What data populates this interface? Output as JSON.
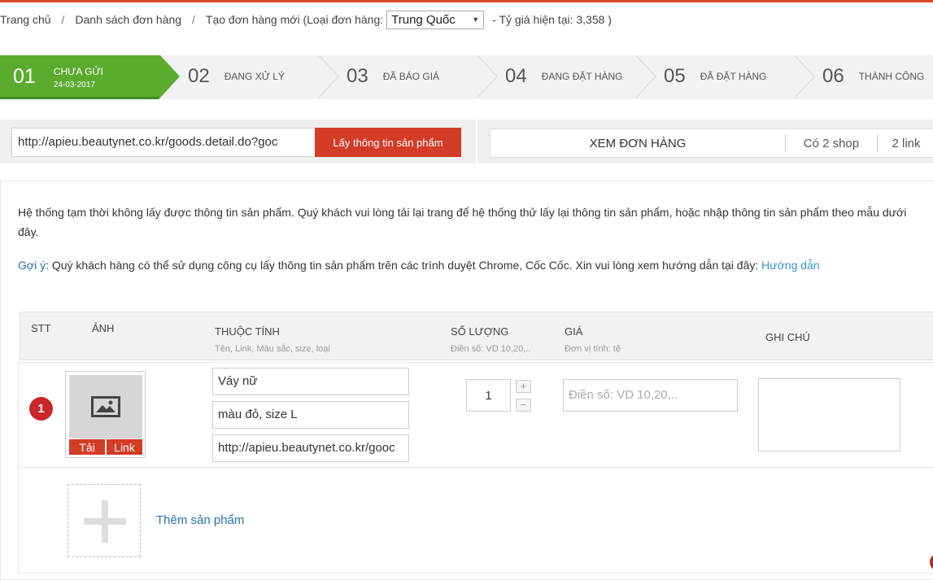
{
  "breadcrumb": {
    "home": "Trang chủ",
    "orders": "Danh sách đơn hàng",
    "new_order_prefix": "Tạo đơn hàng mới (Loại đơn hàng:",
    "order_type": "Trung Quốc",
    "rate_text": "- Tỷ giá hiện tại: 3,358 )"
  },
  "steps": [
    {
      "num": "01",
      "label": "Chưa gửi",
      "date": "24-03-2017",
      "active": true
    },
    {
      "num": "02",
      "label": "Đang xử lý"
    },
    {
      "num": "03",
      "label": "Đã báo giá"
    },
    {
      "num": "04",
      "label": "Đang đặt hàng"
    },
    {
      "num": "05",
      "label": "Đã đặt hàng"
    },
    {
      "num": "06",
      "label": "Thành công"
    }
  ],
  "url_bar": {
    "value": "http://apieu.beautynet.co.kr/goods.detail.do?goc",
    "fetch_label": "Lấy thông tin sản phẩm"
  },
  "view_bar": {
    "view_label": "XEM ĐƠN HÀNG",
    "shops": "Có 2 shop",
    "links": "2 link"
  },
  "notice": "Hệ thống tạm thời không lấy được thông tin sản phẩm. Quý khách vui lòng tải lại trang để hệ thống thử lấy lại thông tin sản phẩm, hoặc nhập thông tin sản phẩm theo mẫu dưới đây.",
  "hint": {
    "prefix": "Gợi ý",
    "text": ": Quý khách hàng có thể sử dụng công cụ lấy thông tin sản phẩm trên các trình duyệt Chrome, Cốc Cốc. Xin vui lòng xem hướng dẫn tại đây: ",
    "link": "Hướng dẫn"
  },
  "table": {
    "headers": {
      "stt": "STT",
      "image": "Ảnh",
      "attributes": "Thuộc tính",
      "attributes_sub": "Tên, Link, Màu sắc, size, loại",
      "quantity": "Số lượng",
      "quantity_sub": "Điền số: VD 10,20,..",
      "price": "Giá",
      "price_sub": "Đơn vị tính: tệ",
      "note": "Ghi chú"
    },
    "rows": [
      {
        "index": "1",
        "upload_label": "Tải",
        "link_label": "Link",
        "name": "Váy nữ",
        "variant": "màu đỏ, size L",
        "url": "http://apieu.beautynet.co.kr/gooc",
        "quantity": "1",
        "qty_plus": "+",
        "qty_minus": "−",
        "price_placeholder": "Điền số: VD 10,20,..",
        "note": ""
      }
    ],
    "add_label": "Thêm sản phẩm"
  }
}
